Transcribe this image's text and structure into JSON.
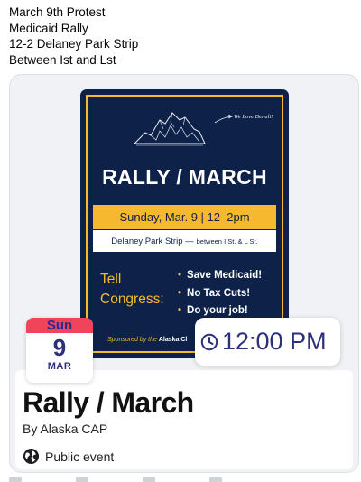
{
  "post": {
    "lines": [
      "March 9th Protest",
      "Medicaid Rally",
      "12-2 Delaney Park Strip",
      "Between Ist and Lst"
    ]
  },
  "flyer": {
    "tagline": "We Love Denali!",
    "title": "RALLY / MARCH",
    "date_time": "Sunday, Mar. 9  |  12–2pm",
    "place": "Delaney Park Strip —",
    "place_detail": "between I St. & L St.",
    "tell_line1": "Tell",
    "tell_line2": "Congress:",
    "demands": [
      "Save Medicaid!",
      "No Tax Cuts!",
      "Do your job!"
    ],
    "sponsor_prefix": "Sponsored by the",
    "sponsor_name": "Alaska Cl"
  },
  "event": {
    "weekday": "Sun",
    "day": "9",
    "month": "MAR",
    "time": "12:00 PM",
    "title": "Rally / March",
    "host": "By Alaska CAP",
    "privacy": "Public event"
  },
  "colors": {
    "navy": "#0e2249",
    "gold": "#f5b82e",
    "cal_red": "#f0445a",
    "accent_text": "#2c2f7a"
  },
  "icons": {
    "clock": "clock-icon",
    "globe": "globe-icon"
  }
}
